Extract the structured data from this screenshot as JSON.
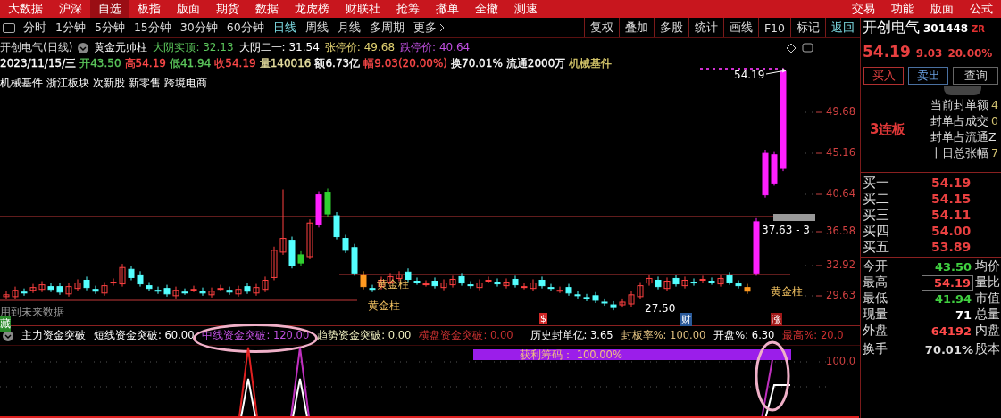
{
  "menu_bar": {
    "left": [
      {
        "label": "大数据",
        "selected": false
      },
      {
        "label": "沪深",
        "selected": false
      },
      {
        "label": "自选",
        "selected": true
      },
      {
        "label": "板指",
        "selected": false
      },
      {
        "label": "版面",
        "selected": false
      },
      {
        "label": "期货",
        "selected": false
      },
      {
        "label": "数据",
        "selected": false
      },
      {
        "label": "龙虎榜",
        "selected": false
      },
      {
        "label": "财联社",
        "selected": false
      },
      {
        "label": "抢筹",
        "selected": false
      },
      {
        "label": "撤单",
        "selected": false
      },
      {
        "label": "全撤",
        "selected": false
      },
      {
        "label": "测速",
        "selected": false
      }
    ],
    "right": [
      "交易",
      "功能",
      "版面",
      "公式"
    ]
  },
  "period_tabs": [
    {
      "label": "分时",
      "selected": false
    },
    {
      "label": "1分钟",
      "selected": false
    },
    {
      "label": "5分钟",
      "selected": false
    },
    {
      "label": "15分钟",
      "selected": false
    },
    {
      "label": "30分钟",
      "selected": false
    },
    {
      "label": "60分钟",
      "selected": false
    },
    {
      "label": "日线",
      "selected": true
    },
    {
      "label": "周线",
      "selected": false
    },
    {
      "label": "月线",
      "selected": false
    },
    {
      "label": "多周期",
      "selected": false
    },
    {
      "label": "更多",
      "selected": false
    }
  ],
  "tool_buttons": [
    {
      "label": "复权",
      "selected": false
    },
    {
      "label": "叠加",
      "selected": false
    },
    {
      "label": "多股",
      "selected": false
    },
    {
      "label": "统计",
      "selected": false
    },
    {
      "label": "画线",
      "selected": false
    },
    {
      "label": "F10",
      "selected": false
    },
    {
      "label": "标记",
      "selected": false
    },
    {
      "label": "返回",
      "selected": true
    }
  ],
  "chart": {
    "title": "开创电气(日线)",
    "indicator": "黄金元帅柱",
    "header_values": [
      {
        "text": "大阴实顶: 32.13",
        "color": "#5cc85c"
      },
      {
        "text": "大阴二一: 31.54",
        "color": "#ffffff"
      },
      {
        "text": "张停价: 49.68",
        "color": "#e0d070"
      },
      {
        "text": "跌停价: 40.64",
        "color": "#c050e0"
      }
    ],
    "quote_line": [
      {
        "text": "2023/11/15/三",
        "color": "#ffffff"
      },
      {
        "text": "开43.50",
        "color": "#5cc85c"
      },
      {
        "text": "高54.19",
        "color": "#ff4a4a"
      },
      {
        "text": "低41.94",
        "color": "#5cc85c"
      },
      {
        "text": "收54.19",
        "color": "#ff4a4a"
      },
      {
        "text": "量140016",
        "color": "#e8e0a0"
      },
      {
        "text": "额6.73亿",
        "color": "#ffffff"
      },
      {
        "text": "幅9.03(20.00%)",
        "color": "#ff4a4a"
      },
      {
        "text": "换70.01%",
        "color": "#ffffff"
      },
      {
        "text": "流通2000万",
        "color": "#ffffff"
      },
      {
        "text": "机械基件",
        "color": "#e0d070"
      }
    ],
    "tags": [
      "机械基件",
      "浙江板块",
      "次新股",
      "新零售",
      "跨境电商"
    ],
    "y_axis": [
      "49.68",
      "45.16",
      "40.64",
      "36.58",
      "32.92",
      "29.63"
    ],
    "price_labels": [
      "54.19",
      "37.63 - 3",
      "黄金柱",
      "黄金柱",
      "黄金柱",
      "27.50"
    ],
    "notes": [
      "用到未来数据",
      "藏"
    ],
    "markers": [
      {
        "text": "$",
        "color": "#d02828"
      },
      {
        "text": "财",
        "color": "#2a5a9a"
      },
      {
        "text": "涨",
        "color": "#a01818"
      }
    ]
  },
  "indicator_panel": {
    "name": "主力资金突破",
    "values": [
      {
        "text": "短线资金突破: 60.00",
        "color": "#ffffff"
      },
      {
        "text": "中线资金突破: 120.00",
        "color": "#c050e0"
      },
      {
        "text": "趋势资金突破: 0.00",
        "color": "#f0f0c0"
      },
      {
        "text": "横盘资金突破: 0.00",
        "color": "#c83030"
      },
      {
        "text": "历史封单亿: 3.65",
        "color": "#ffffff"
      },
      {
        "text": "封板率%: 100.00",
        "color": "#e0c080"
      },
      {
        "text": "开盘%: 6.30",
        "color": "#ffffff"
      },
      {
        "text": "最高%: 20.0",
        "color": "#d03030"
      }
    ],
    "profit_band": "获利筹码： 100.00%",
    "y_axis": "100.0"
  },
  "quote_panel": {
    "name": "开创电气",
    "code": "301448",
    "flag": "ZR",
    "price": "54.19",
    "change": "9.03",
    "change_pct": "20.00%",
    "buttons": [
      "买入",
      "卖出",
      "查询"
    ],
    "streak": "3连板",
    "seal_info": [
      {
        "label": "当前封单额",
        "value": "4"
      },
      {
        "label": "封单占成交",
        "value": "0"
      },
      {
        "label": "封单占流通Z"
      },
      {
        "label": "十日总张幅",
        "value": "7"
      }
    ],
    "bids": [
      {
        "label": "买一",
        "price": "54.19"
      },
      {
        "label": "买二",
        "price": "54.15"
      },
      {
        "label": "买三",
        "price": "54.11"
      },
      {
        "label": "买四",
        "price": "54.00"
      },
      {
        "label": "买五",
        "price": "53.89"
      }
    ],
    "stats": [
      {
        "label": "今开",
        "value": "43.50",
        "color": "#40d040",
        "boxed": false,
        "right": "均价"
      },
      {
        "label": "最高",
        "value": "54.19",
        "color": "#ff4a4a",
        "boxed": true,
        "right": "量比"
      },
      {
        "label": "最低",
        "value": "41.94",
        "color": "#40d040",
        "boxed": false,
        "right": "市值"
      },
      {
        "label": "现量",
        "value": "71",
        "color": "#ffffff",
        "boxed": false,
        "right": "总量"
      },
      {
        "label": "外盘",
        "value": "64192",
        "color": "#ff4a4a",
        "boxed": false,
        "right": "内盘"
      }
    ],
    "turnover": {
      "label": "换手",
      "value": "70.01%",
      "right": "股本"
    }
  }
}
